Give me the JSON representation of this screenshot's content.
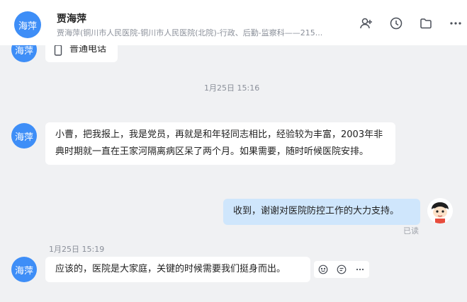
{
  "header": {
    "name": "贾海萍",
    "avatar_text": "海萍",
    "subtitle": "贾海萍(铜川市人民医院-铜川市人民医院(北院)-行政、后勤-监察科——215..."
  },
  "messages": {
    "m0": {
      "avatar_text": "海萍",
      "text": "普通电话"
    },
    "time1": "1月25日 15:16",
    "m1": {
      "avatar_text": "海萍",
      "text": "小曹，把我报上，我是党员，再就是和年轻同志相比，经验较为丰富，2003年非典时期就一直在王家河隔离病区呆了两个月。如果需要，随时听候医院安排。"
    },
    "m2": {
      "text": "收到，谢谢对医院防控工作的大力支持。",
      "status": "已读"
    },
    "time2": "1月25日 15:19",
    "m3": {
      "avatar_text": "海萍",
      "text": "应该的，医院是大家庭，关键的时候需要我们挺身而出。"
    }
  },
  "colors": {
    "accent": "#3e8ef7",
    "self_bubble": "#cfe6fc",
    "background": "#f0f1f3"
  },
  "icons": [
    "add-user-icon",
    "clock-icon",
    "folder-icon",
    "more-icon",
    "phone-icon",
    "emoji-icon",
    "reply-icon"
  ]
}
